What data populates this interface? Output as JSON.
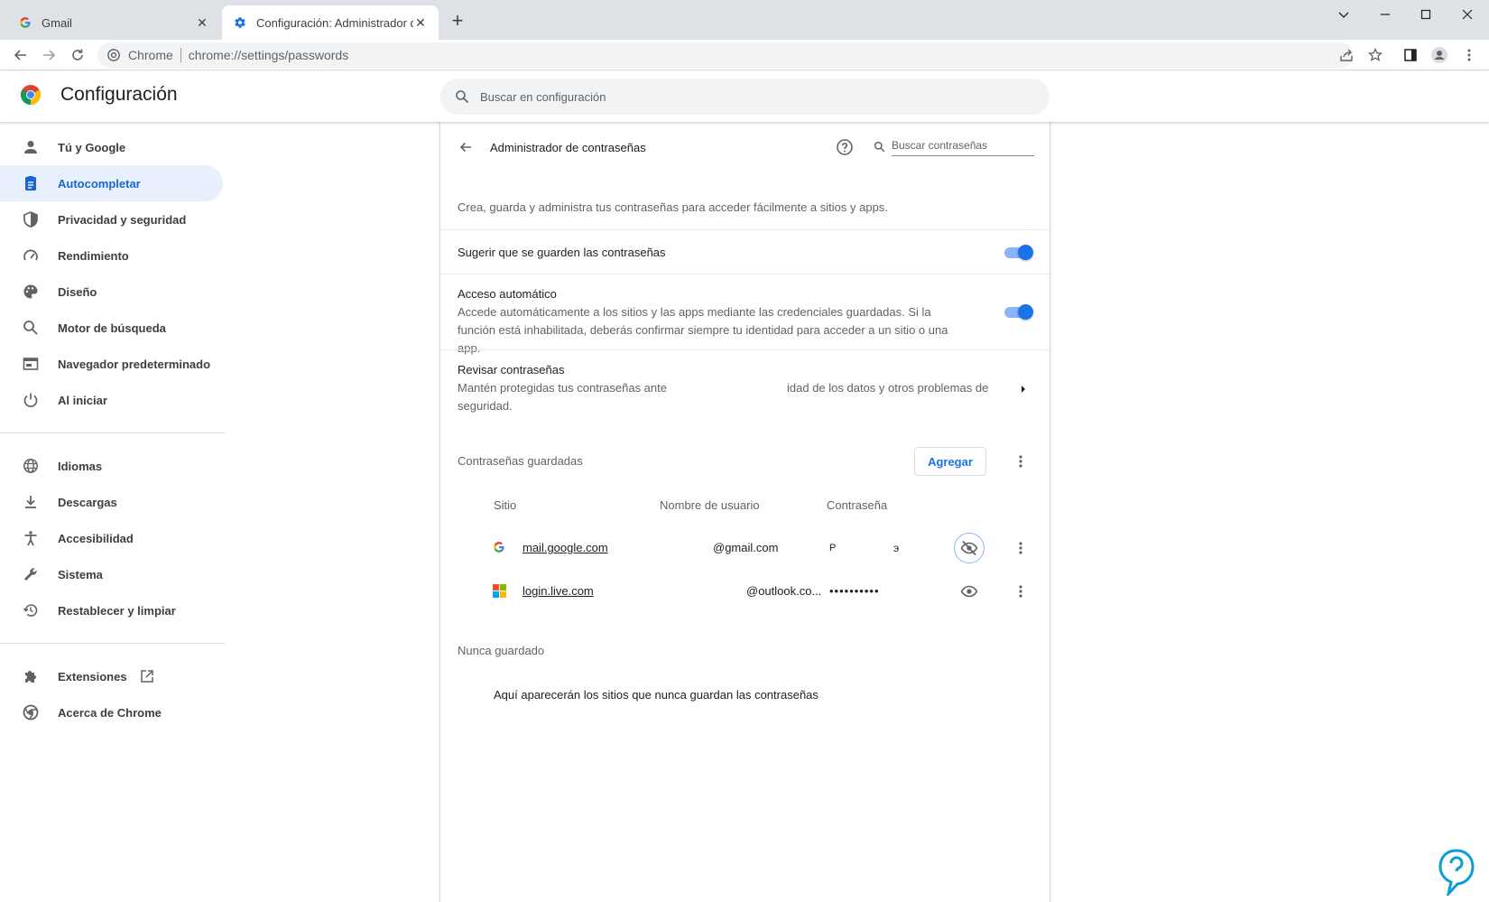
{
  "browser": {
    "tabs": [
      {
        "title": "Gmail",
        "active": false
      },
      {
        "title": "Configuración: Administrador de contraseñas",
        "active": true
      }
    ],
    "omnibox": {
      "chip": "Chrome",
      "url": "chrome://settings/passwords"
    }
  },
  "settings": {
    "title": "Configuración",
    "search_placeholder": "Buscar en configuración"
  },
  "sidebar": {
    "items": [
      {
        "label": "Tú y Google",
        "icon": "person-icon"
      },
      {
        "label": "Autocompletar",
        "icon": "autofill-icon",
        "selected": true
      },
      {
        "label": "Privacidad y seguridad",
        "icon": "shield-icon"
      },
      {
        "label": "Rendimiento",
        "icon": "speedometer-icon"
      },
      {
        "label": "Diseño",
        "icon": "palette-icon"
      },
      {
        "label": "Motor de búsqueda",
        "icon": "search-icon"
      },
      {
        "label": "Navegador predeterminado",
        "icon": "browser-icon"
      },
      {
        "label": "Al iniciar",
        "icon": "power-icon"
      }
    ],
    "items2": [
      {
        "label": "Idiomas",
        "icon": "globe-icon"
      },
      {
        "label": "Descargas",
        "icon": "download-icon"
      },
      {
        "label": "Accesibilidad",
        "icon": "accessibility-icon"
      },
      {
        "label": "Sistema",
        "icon": "wrench-icon"
      },
      {
        "label": "Restablecer y limpiar",
        "icon": "restore-icon"
      }
    ],
    "items3": [
      {
        "label": "Extensiones",
        "icon": "puzzle-icon"
      },
      {
        "label": "Acerca de Chrome",
        "icon": "chrome-icon"
      }
    ]
  },
  "passwords": {
    "title": "Administrador de contraseñas",
    "search_placeholder": "Buscar contraseñas",
    "description": "Crea, guarda y administra tus contraseñas para acceder fácilmente a sitios y apps.",
    "offer_to_save": {
      "label": "Sugerir que se guarden las contraseñas",
      "enabled": true
    },
    "auto_signin": {
      "label": "Acceso automático",
      "sub": "Accede automáticamente a los sitios y las apps mediante las credenciales guardadas. Si la función está inhabilitada, deberás confirmar siempre tu identidad para acceder a un sitio o una app.",
      "enabled": true
    },
    "check": {
      "label": "Revisar contraseñas",
      "sub_part1": "Mantén protegidas tus contraseñas ante",
      "sub_part2": "idad de los datos y otros problemas de",
      "sub_part3": "seguridad."
    },
    "saved": {
      "title": "Contraseñas guardadas",
      "add_label": "Agregar",
      "columns": [
        "Sitio",
        "Nombre de usuario",
        "Contraseña"
      ],
      "rows": [
        {
          "site": "mail.google.com",
          "user": "@gmail.com",
          "password_start": "P",
          "password_end": "э",
          "icon": "google-icon",
          "revealed": true
        },
        {
          "site": "login.live.com",
          "user": "@outlook.co...",
          "password": "••••••••••",
          "icon": "microsoft-icon",
          "revealed": false
        }
      ]
    },
    "never": {
      "title": "Nunca guardado",
      "empty": "Aquí aparecerán los sitios que nunca guardan las contraseñas"
    }
  }
}
